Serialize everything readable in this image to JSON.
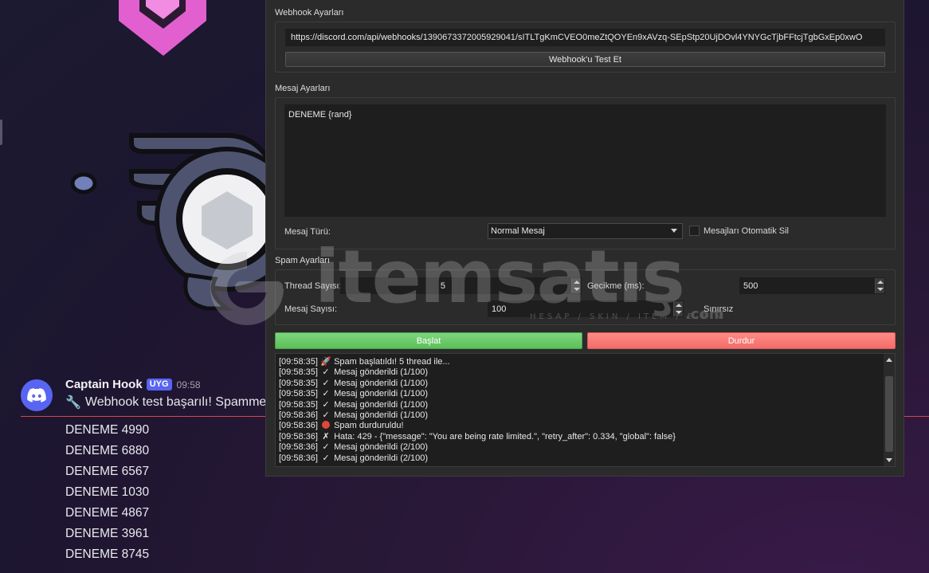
{
  "discord": {
    "author": "Captain Hook",
    "tag": "UYG",
    "time": "09:58",
    "message_icon": "wrench-icon",
    "message_text": "Webhook test başarılı! Spammer h",
    "messages": [
      "DENEME 4990",
      "DENEME 6880",
      "DENEME 6567",
      "DENEME 1030",
      "DENEME 4867",
      "DENEME 3961",
      "DENEME 8745"
    ]
  },
  "app": {
    "webhook": {
      "group_title": "Webhook Ayarları",
      "url": "https://discord.com/api/webhooks/1390673372005929041/sITLTgKmCVEO0meZtQOYEn9xAVzq-SEpStp20UjDOvl4YNYGcTjbFFtcjTgbGxEp0xwO",
      "test_button": "Webhook'u Test Et"
    },
    "message": {
      "group_title": "Mesaj Ayarları",
      "content": "DENEME {rand}",
      "type_label": "Mesaj Türü:",
      "type_value": "Normal Mesaj",
      "auto_delete_label": "Mesajları Otomatik Sil"
    },
    "spam": {
      "group_title": "Spam Ayarları",
      "thread_label": "Thread Sayısı:",
      "thread_value": "5",
      "delay_label": "Gecikme (ms):",
      "delay_value": "500",
      "count_label": "Mesaj Sayısı:",
      "count_value": "100",
      "unlimited_label": "Sınırsız"
    },
    "start_button": "Başlat",
    "stop_button": "Durdur",
    "log": [
      {
        "time": "[09:58:35]",
        "icon": "rocket-icon",
        "glyph": "🚀",
        "text": "Spam başlatıldı! 5 thread ile..."
      },
      {
        "time": "[09:58:35]",
        "icon": "check-icon",
        "glyph": "✓",
        "text": "Mesaj gönderildi (1/100)"
      },
      {
        "time": "[09:58:35]",
        "icon": "check-icon",
        "glyph": "✓",
        "text": "Mesaj gönderildi (1/100)"
      },
      {
        "time": "[09:58:35]",
        "icon": "check-icon",
        "glyph": "✓",
        "text": "Mesaj gönderildi (1/100)"
      },
      {
        "time": "[09:58:35]",
        "icon": "check-icon",
        "glyph": "✓",
        "text": "Mesaj gönderildi (1/100)"
      },
      {
        "time": "[09:58:36]",
        "icon": "check-icon",
        "glyph": "✓",
        "text": "Mesaj gönderildi (1/100)"
      },
      {
        "time": "[09:58:36]",
        "icon": "red-circle-icon",
        "glyph": "",
        "text": "Spam durduruldu!"
      },
      {
        "time": "[09:58:36]",
        "icon": "cross-icon",
        "glyph": "✗",
        "text": "Hata: 429 - {\"message\": \"You are being rate limited.\", \"retry_after\": 0.334, \"global\": false}"
      },
      {
        "time": "[09:58:36]",
        "icon": "check-icon",
        "glyph": "✓",
        "text": "Mesaj gönderildi (2/100)"
      },
      {
        "time": "[09:58:36]",
        "icon": "check-icon",
        "glyph": "✓",
        "text": "Mesaj gönderildi (2/100)"
      }
    ]
  },
  "watermark": {
    "brand": "itemsatış",
    "subtitle": "HESAP / SKIN / ITEM / E-PIN",
    "suffix": ".com"
  },
  "colors": {
    "discord_blurple": "#5865f2",
    "start_green": "#6fcc6d",
    "stop_red": "#f77b77",
    "window_bg": "#2b2b2b",
    "field_bg": "#1e1e1e"
  }
}
